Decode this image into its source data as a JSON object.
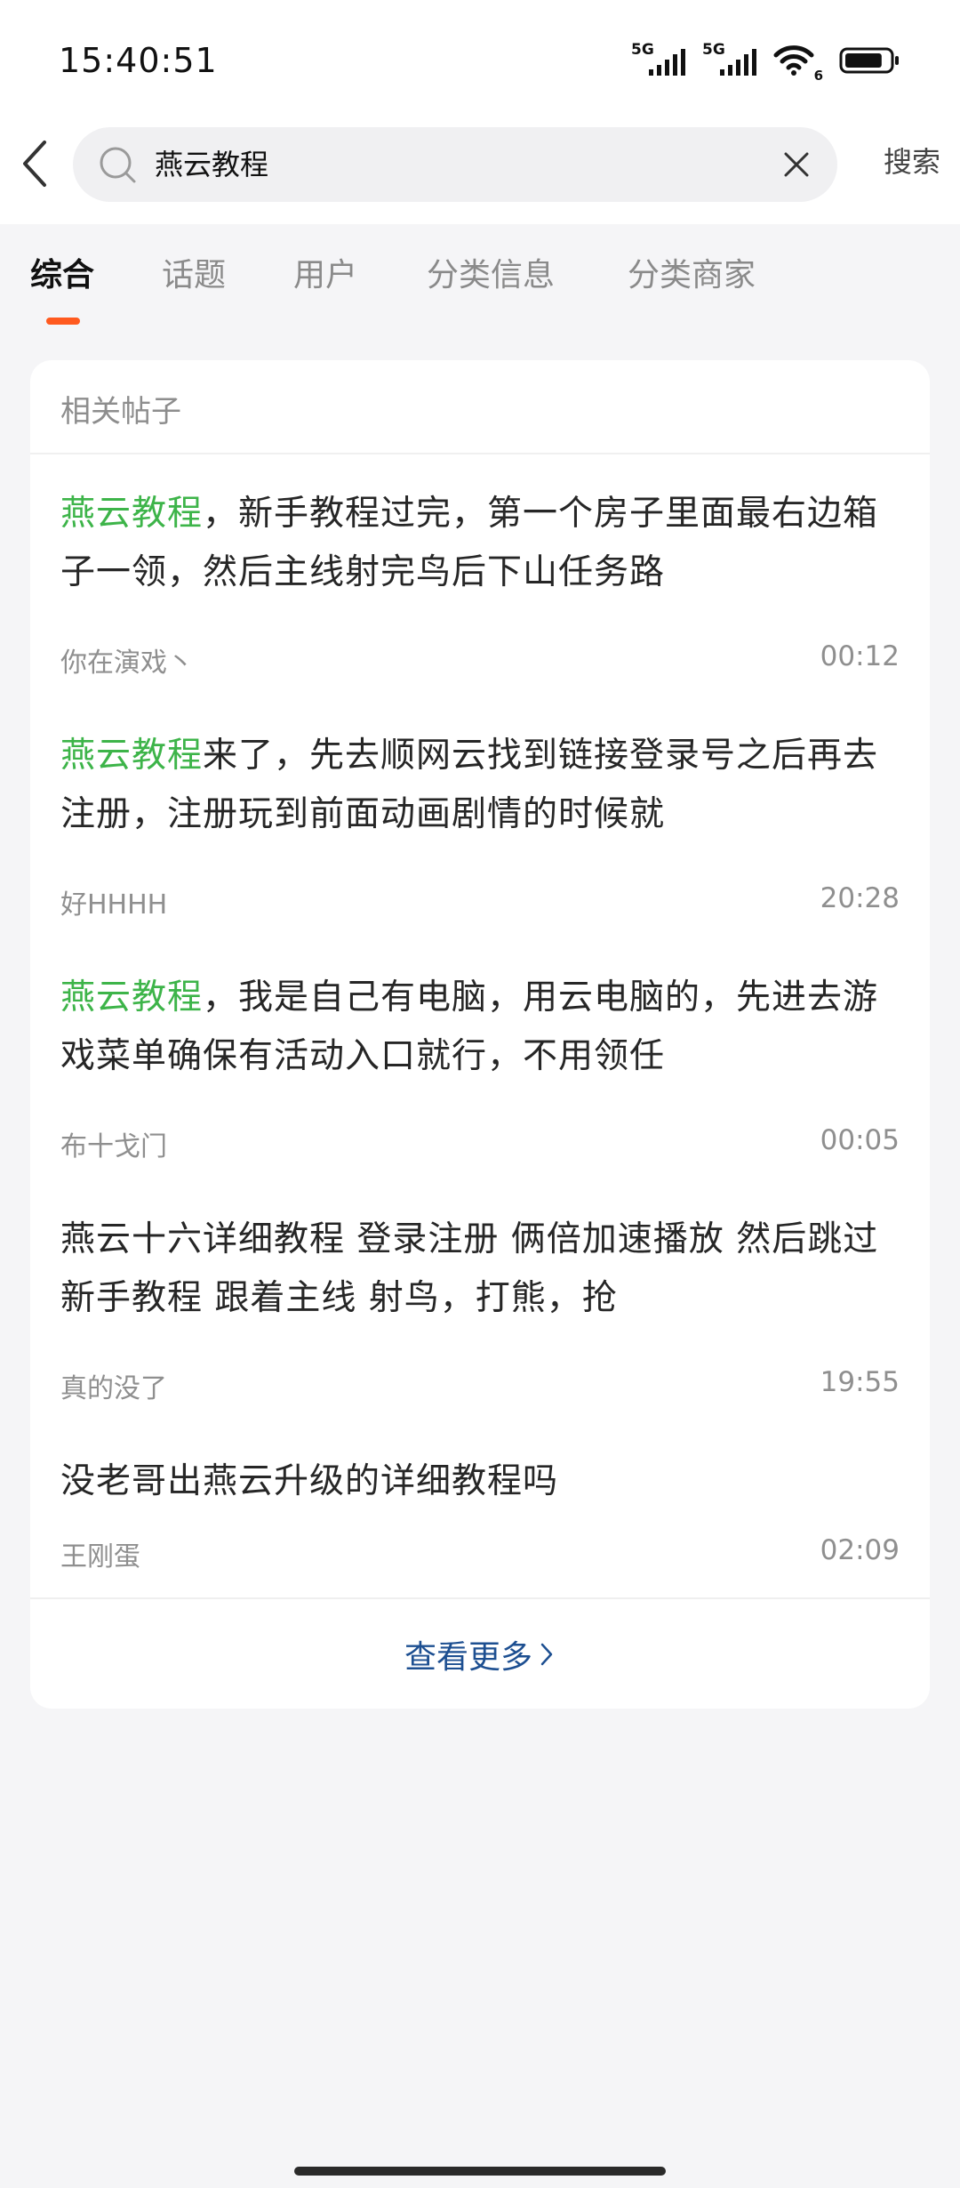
{
  "status_bar": {
    "time": "15:40:51",
    "sim1_label": "5G",
    "sim2_label": "5G",
    "wifi_label": "6",
    "icons": [
      "signal-icon",
      "signal-icon",
      "wifi-icon",
      "battery-icon"
    ],
    "battery_level": 0.85
  },
  "search": {
    "back_icon": "chevron-left-icon",
    "search_icon": "search-icon",
    "query": "燕云教程",
    "clear_icon": "close-icon",
    "submit_label": "搜索"
  },
  "tabs": [
    {
      "label": "综合",
      "active": true
    },
    {
      "label": "话题",
      "active": false
    },
    {
      "label": "用户",
      "active": false
    },
    {
      "label": "分类信息",
      "active": false
    },
    {
      "label": "分类商家",
      "active": false
    }
  ],
  "colors": {
    "accent": "#ff5a1f",
    "highlight": "#3db449",
    "link": "#1d4f91"
  },
  "related_posts": {
    "header": "相关帖子",
    "posts": [
      {
        "highlight": "燕云教程",
        "title_rest": "，新手教程过完，第一个房子里面最右边箱子一领，然后主线射完鸟后下山任务路",
        "author": "你在演戏丶",
        "time": "00:12"
      },
      {
        "highlight": "燕云教程",
        "title_rest": "来了，先去顺网云找到链接登录号之后再去注册，注册玩到前面动画剧情的时候就",
        "author": "好HHHH",
        "time": "20:28"
      },
      {
        "highlight": "燕云教程",
        "title_rest": "，我是自己有电脑，用云电脑的，先进去游戏菜单确保有活动入口就行，不用领任",
        "author": "布十戈门",
        "time": "00:05"
      },
      {
        "highlight": "",
        "title_rest": "燕云十六详细教程 登录注册 俩倍加速播放 然后跳过新手教程 跟着主线 射鸟，打熊，抢",
        "author": "真的没了",
        "time": "19:55"
      },
      {
        "highlight": "",
        "title_rest": "没老哥出燕云升级的详细教程吗",
        "author": "王刚蛋",
        "time": "02:09"
      }
    ],
    "more_label": "查看更多",
    "more_icon": "chevron-right-icon"
  }
}
